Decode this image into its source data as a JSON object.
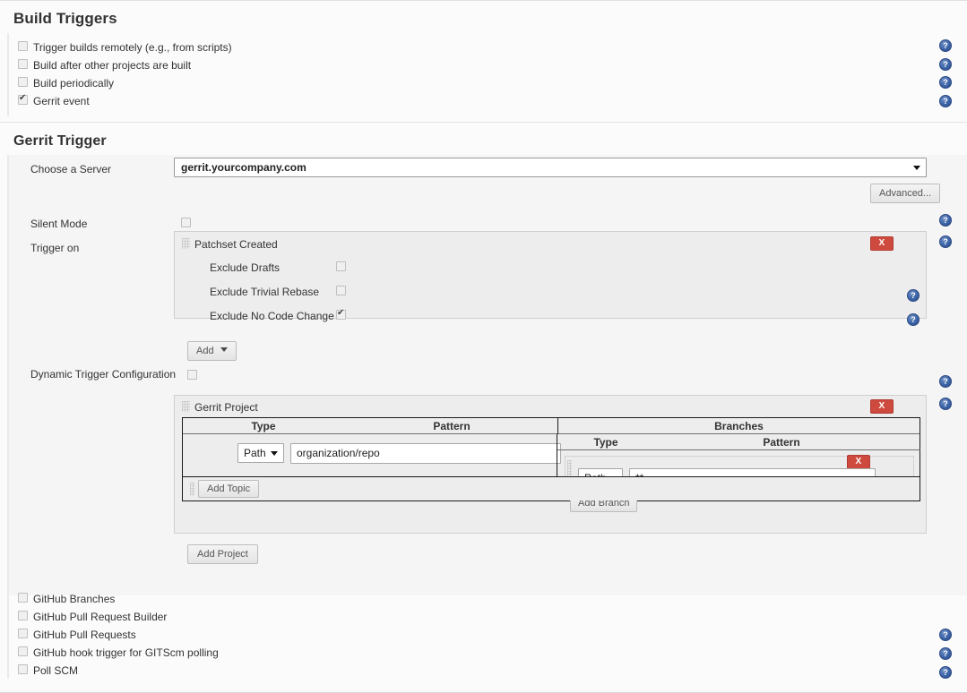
{
  "build_triggers": {
    "title": "Build Triggers",
    "options": [
      {
        "label": "Trigger builds remotely (e.g., from scripts)",
        "checked": false
      },
      {
        "label": "Build after other projects are built",
        "checked": false
      },
      {
        "label": "Build periodically",
        "checked": false
      },
      {
        "label": "Gerrit event",
        "checked": true
      }
    ]
  },
  "gerrit_trigger": {
    "title": "Gerrit Trigger",
    "choose_server": {
      "label": "Choose a Server",
      "value": "gerrit.yourcompany.com"
    },
    "advanced_button": "Advanced...",
    "silent_mode": {
      "label": "Silent Mode",
      "checked": false
    },
    "trigger_on": {
      "label": "Trigger on",
      "panel_title": "Patchset Created",
      "delete_label": "X",
      "options": [
        {
          "label": "Exclude Drafts",
          "checked": false
        },
        {
          "label": "Exclude Trivial Rebase",
          "checked": false
        },
        {
          "label": "Exclude No Code Change",
          "checked": true
        }
      ],
      "add_button": "Add"
    },
    "dynamic_trigger": {
      "label": "Dynamic Trigger Configuration",
      "checked": false
    },
    "gerrit_project": {
      "panel_title": "Gerrit Project",
      "delete_label": "X",
      "headers": {
        "type": "Type",
        "pattern": "Pattern"
      },
      "type_value": "Path",
      "pattern_value": "organization/repo",
      "add_topic_button": "Add Topic",
      "add_project_button": "Add Project",
      "branches": {
        "header": "Branches",
        "headers": {
          "type": "Type",
          "pattern": "Pattern"
        },
        "type_value": "Path",
        "pattern_value": "**",
        "delete_label": "X",
        "add_branch_button": "Add Branch"
      }
    }
  },
  "bottom_triggers": {
    "options": [
      {
        "label": "GitHub Branches",
        "checked": false
      },
      {
        "label": "GitHub Pull Request Builder",
        "checked": false
      },
      {
        "label": "GitHub Pull Requests",
        "checked": false
      },
      {
        "label": "GitHub hook trigger for GITScm polling",
        "checked": false
      },
      {
        "label": "Poll SCM",
        "checked": false
      }
    ]
  },
  "icons": {
    "help": "help-icon",
    "drag": "drag-handle-icon",
    "caret": "chevron-down-icon"
  }
}
